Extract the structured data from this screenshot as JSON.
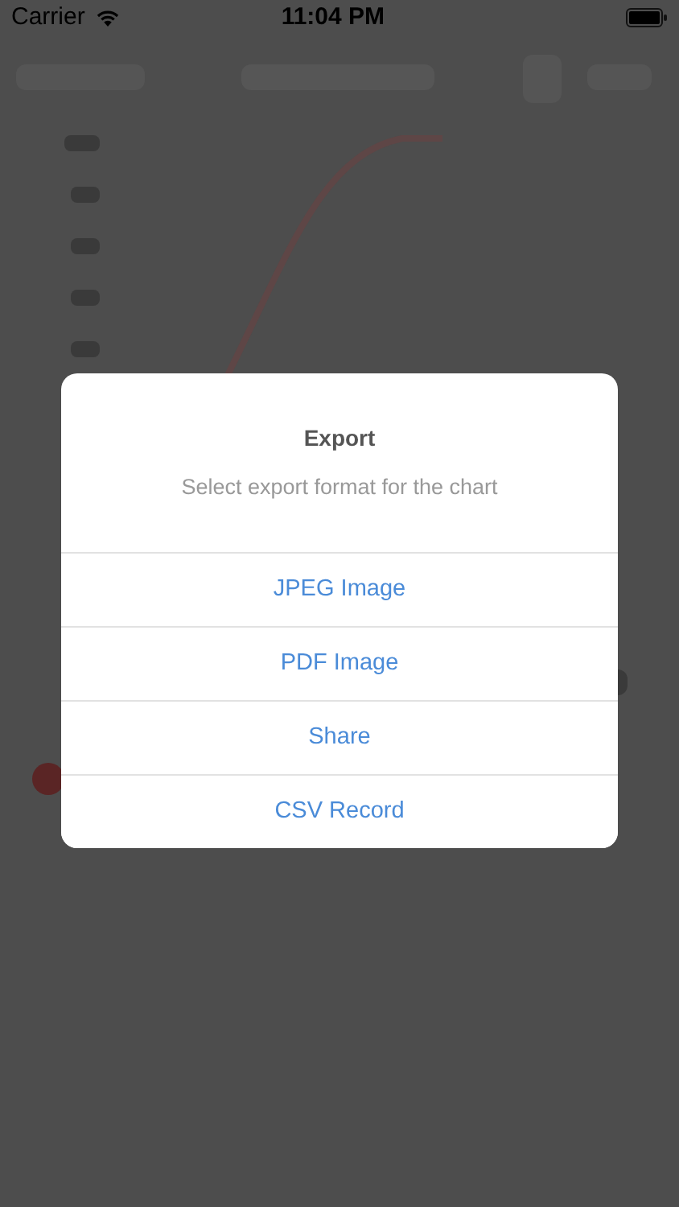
{
  "status_bar": {
    "carrier": "Carrier",
    "time": "11:04 PM"
  },
  "alert": {
    "title": "Export",
    "message": "Select export format for the chart",
    "actions": [
      {
        "label": "JPEG Image"
      },
      {
        "label": "PDF Image"
      },
      {
        "label": "Share"
      },
      {
        "label": "CSV Record"
      }
    ]
  }
}
